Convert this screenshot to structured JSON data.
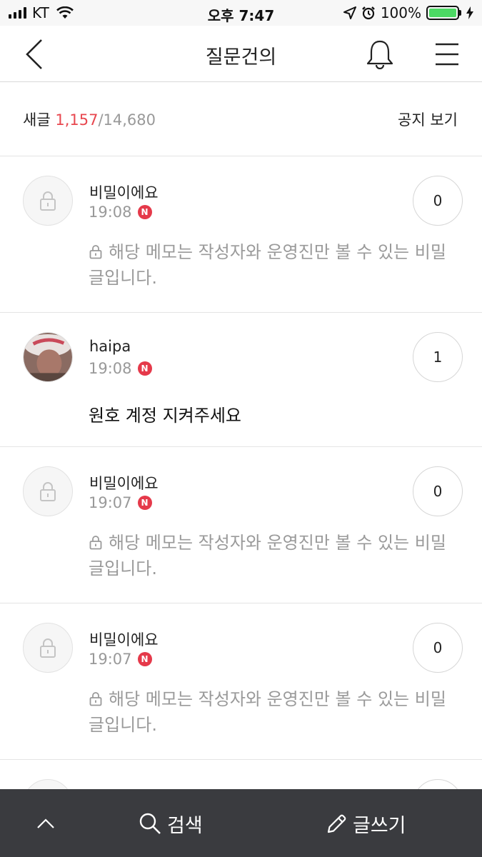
{
  "status_bar": {
    "carrier": "KT",
    "time": "오후 7:47",
    "battery_percent": "100%",
    "battery_level": 1.0,
    "battery_color": "#4cd964"
  },
  "header": {
    "title": "질문건의",
    "icons": [
      "back-arrow-icon",
      "bell-icon",
      "hamburger-menu-icon"
    ]
  },
  "summary": {
    "label": "새글",
    "new_count": "1,157",
    "total_count": "/14,680",
    "notice_label": "공지 보기",
    "accent_color": "#e8474f"
  },
  "posts": [
    {
      "author": "비밀이에요",
      "time": "19:08",
      "badge": "N",
      "comments": "0",
      "secret": true,
      "text": "해당 메모는 작성자와 운영진만 볼 수 있는 비밀글입니다."
    },
    {
      "author": "haipa",
      "time": "19:08",
      "badge": "N",
      "comments": "1",
      "secret": false,
      "text": "원호 계정 지켜주세요"
    },
    {
      "author": "비밀이에요",
      "time": "19:07",
      "badge": "N",
      "comments": "0",
      "secret": true,
      "text": "해당 메모는 작성자와 운영진만 볼 수 있는 비밀글입니다."
    },
    {
      "author": "비밀이에요",
      "time": "19:07",
      "badge": "N",
      "comments": "0",
      "secret": true,
      "text": "해당 메모는 작성자와 운영진만 볼 수 있는 비밀글입니다."
    }
  ],
  "bottom_bar": {
    "search_label": "검색",
    "write_label": "글쓰기",
    "background_color": "#3a3b3f"
  }
}
